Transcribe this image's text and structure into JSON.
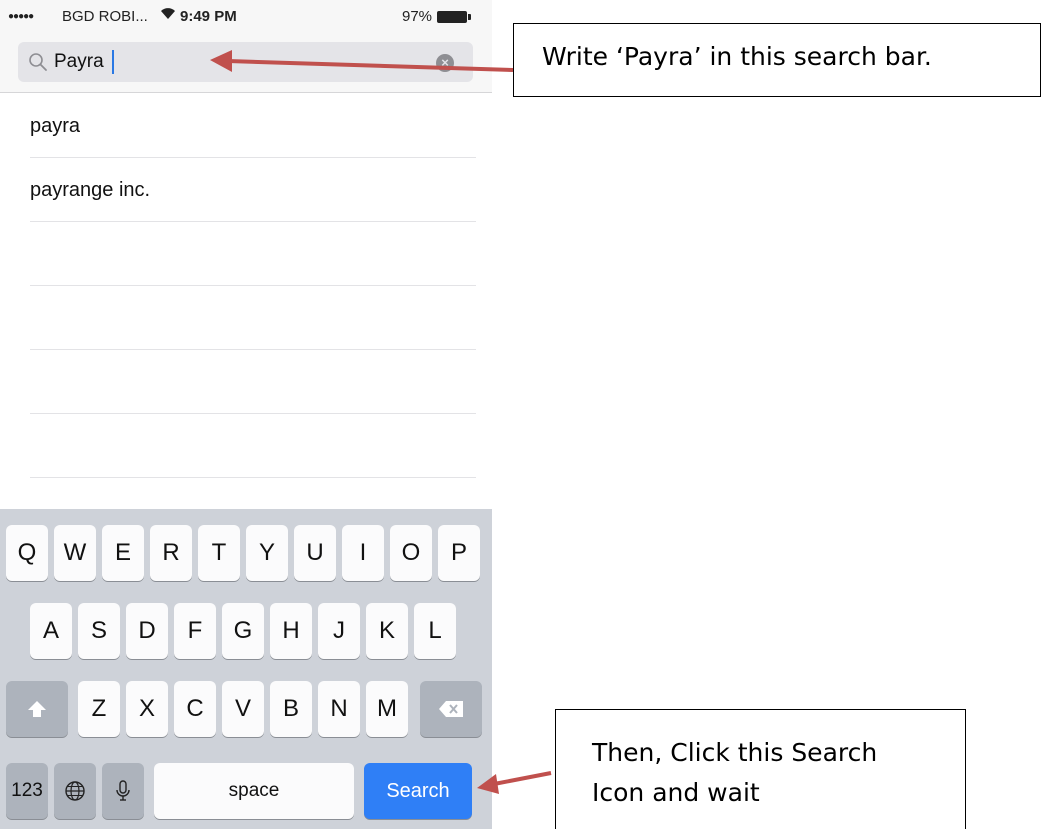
{
  "status_bar": {
    "signal": "●●●●●",
    "carrier": "BGD ROBI...",
    "wifi_icon": "wifi-icon",
    "time": "9:49 PM",
    "battery_percent": "97%",
    "battery_icon": "battery-icon"
  },
  "search": {
    "value": "Payra",
    "icon": "search-icon",
    "clear_icon": "clear-icon"
  },
  "suggestions": [
    {
      "label": "payra"
    },
    {
      "label": "payrange inc."
    }
  ],
  "keyboard": {
    "row1": [
      "Q",
      "W",
      "E",
      "R",
      "T",
      "Y",
      "U",
      "I",
      "O",
      "P"
    ],
    "row2": [
      "A",
      "S",
      "D",
      "F",
      "G",
      "H",
      "J",
      "K",
      "L"
    ],
    "row3": [
      "Z",
      "X",
      "C",
      "V",
      "B",
      "N",
      "M"
    ],
    "shift_icon": "shift-arrow-icon",
    "delete_icon": "backspace-icon",
    "numbers_label": "123",
    "globe_icon": "globe-icon",
    "mic_icon": "microphone-icon",
    "space_label": "space",
    "search_label": "Search"
  },
  "annotations": {
    "search_bar_note": "Write ‘Payra’ in this search bar.",
    "search_button_note_line1": "Then, Click this Search",
    "search_button_note_line2": "Icon and wait"
  },
  "colors": {
    "search_key": "#2f7ff6",
    "arrow": "#c0504d",
    "keyboard_bg": "#ced2d9"
  }
}
